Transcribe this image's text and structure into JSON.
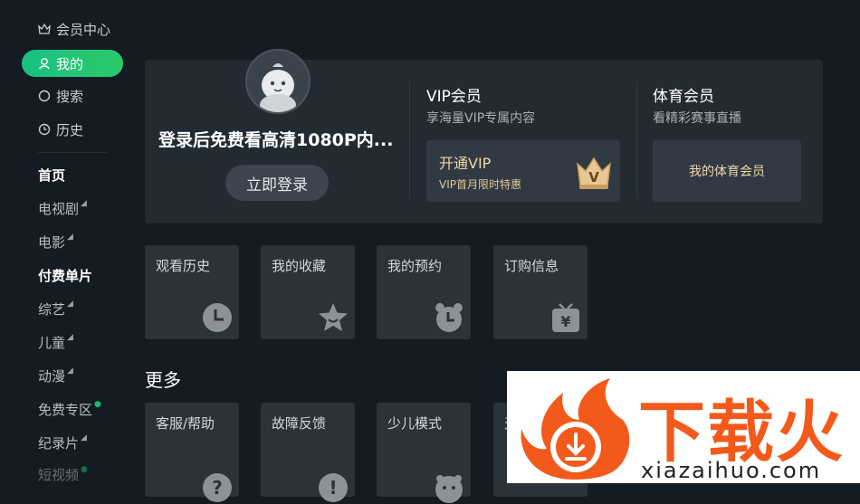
{
  "sidebar": {
    "items": [
      {
        "label": "会员中心",
        "icon": "crown-icon"
      },
      {
        "label": "我的",
        "icon": "user-icon",
        "active": true
      },
      {
        "label": "搜索",
        "icon": "search-icon"
      },
      {
        "label": "历史",
        "icon": "clock-icon"
      }
    ],
    "channels": [
      {
        "label": "首页",
        "bold": true
      },
      {
        "label": "电视剧",
        "mark": "◢"
      },
      {
        "label": "电影",
        "mark": "◢"
      },
      {
        "label": "付费单片",
        "bold": true
      },
      {
        "label": "综艺",
        "mark": "◢"
      },
      {
        "label": "儿童",
        "mark": "◢"
      },
      {
        "label": "动漫",
        "mark": "◢"
      },
      {
        "label": "免费专区",
        "mark": "●"
      },
      {
        "label": "纪录片",
        "mark": "◢"
      },
      {
        "label": "短视频",
        "mark": "●"
      }
    ]
  },
  "account": {
    "login_text": "登录后免费看高清1080P内...",
    "login_button": "立即登录"
  },
  "vip": {
    "title": "VIP会员",
    "subtitle": "享海量VIP专属内容",
    "card_title": "开通VIP",
    "card_sub": "VIP首月限时特惠"
  },
  "sports": {
    "title": "体育会员",
    "subtitle": "看精彩赛事直播",
    "card_label": "我的体育会员"
  },
  "shortcuts": [
    {
      "label": "观看历史",
      "icon": "clock-icon"
    },
    {
      "label": "我的收藏",
      "icon": "star-icon"
    },
    {
      "label": "我的预约",
      "icon": "alarm-icon"
    },
    {
      "label": "订购信息",
      "icon": "tv-yen-icon"
    }
  ],
  "more": {
    "title": "更多",
    "tiles": [
      {
        "label": "客服/帮助",
        "icon": "question-icon"
      },
      {
        "label": "故障反馈",
        "icon": "exclamation-icon"
      },
      {
        "label": "少儿模式",
        "icon": "kid-face-icon"
      },
      {
        "label": "天",
        "icon": ""
      }
    ]
  },
  "watermark": {
    "cn": "下载火",
    "en": "xiazaihuo.com"
  },
  "colors": {
    "background": "#141b22",
    "accent": "#19c084",
    "vip_gold": "#f0d7a8",
    "watermark_orange": "#f25a1c"
  }
}
